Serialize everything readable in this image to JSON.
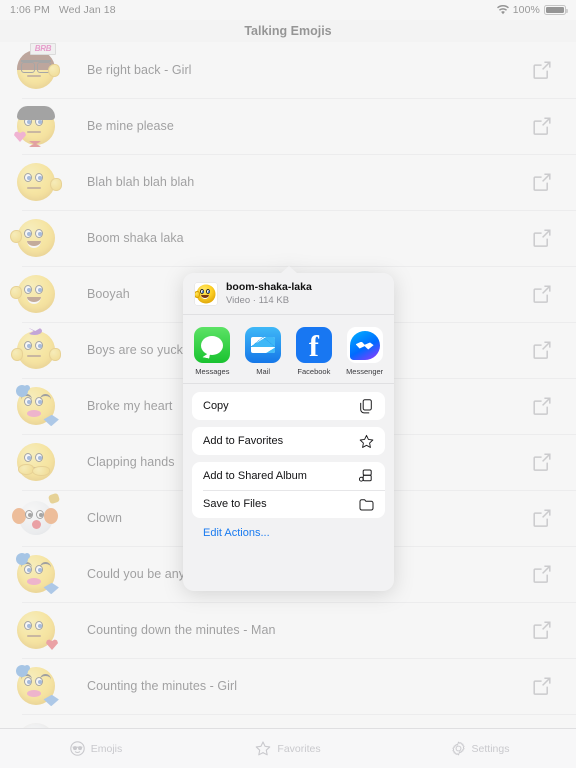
{
  "status_bar": {
    "time": "1:06 PM",
    "date": "Wed Jan 18",
    "battery_percent": "100%",
    "wifi_icon": "wifi-icon",
    "battery_icon": "battery-full-icon"
  },
  "nav": {
    "title": "Talking Emojis"
  },
  "list": {
    "rows": [
      {
        "label": "Be right back - Girl",
        "art": "brb-girl",
        "share_icon": "share-icon"
      },
      {
        "label": "Be mine please",
        "art": "be-mine",
        "share_icon": "share-icon"
      },
      {
        "label": "Blah blah blah blah",
        "art": "blah",
        "share_icon": "share-icon"
      },
      {
        "label": "Boom shaka laka",
        "art": "thumbs-up",
        "share_icon": "share-icon"
      },
      {
        "label": "Booyah",
        "art": "thumbs-up",
        "share_icon": "share-icon"
      },
      {
        "label": "Boys are so yucky",
        "art": "bow-girl",
        "share_icon": "share-icon"
      },
      {
        "label": "Broke my heart",
        "art": "crying-girl",
        "share_icon": "share-icon"
      },
      {
        "label": "Clapping hands",
        "art": "clapping",
        "share_icon": "share-icon"
      },
      {
        "label": "Clown",
        "art": "clown",
        "share_icon": "share-icon"
      },
      {
        "label": "Could you be any cuter",
        "art": "crying-girl",
        "share_icon": "share-icon"
      },
      {
        "label": "Counting down the minutes - Man",
        "art": "heart-man",
        "share_icon": "share-icon"
      },
      {
        "label": "Counting the minutes - Girl",
        "art": "crying-girl",
        "share_icon": "share-icon"
      },
      {
        "label": "",
        "art": "sunglasses-partial",
        "share_icon": "share-icon"
      }
    ]
  },
  "share_sheet": {
    "file_name": "boom-shaka-laka",
    "file_meta": "Video · 114 KB",
    "thumbnail_art": "thumbs-up",
    "apps": [
      {
        "label": "Messages",
        "icon": "messages-app-icon",
        "color": "#19c22f"
      },
      {
        "label": "Mail",
        "icon": "mail-app-icon",
        "color": "#1577e8"
      },
      {
        "label": "Facebook",
        "icon": "facebook-app-icon",
        "color": "#1877f2"
      },
      {
        "label": "Messenger",
        "icon": "messenger-app-icon",
        "color": "#006aff"
      }
    ],
    "action_groups": [
      [
        {
          "label": "Copy",
          "icon": "copy-icon"
        }
      ],
      [
        {
          "label": "Add to Favorites",
          "icon": "star-icon"
        }
      ],
      [
        {
          "label": "Add to Shared Album",
          "icon": "shared-album-icon"
        },
        {
          "label": "Save to Files",
          "icon": "folder-icon"
        }
      ]
    ],
    "edit_actions_label": "Edit Actions...",
    "edit_actions_color": "#1a7bf0"
  },
  "tab_bar": {
    "tabs": [
      {
        "label": "Emojis",
        "icon": "sunglasses-emoji-icon"
      },
      {
        "label": "Favorites",
        "icon": "star-icon"
      },
      {
        "label": "Settings",
        "icon": "gear-icon"
      }
    ],
    "inactive_color": "#c9c9cd"
  }
}
